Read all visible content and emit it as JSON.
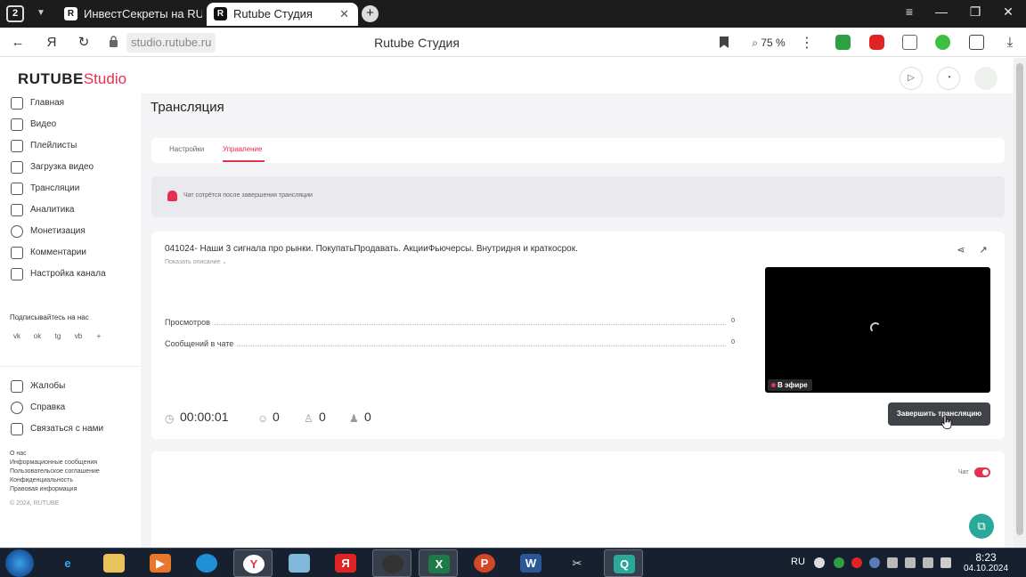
{
  "browser": {
    "tab_count": "2",
    "tabs": [
      {
        "label": "ИнвестСекреты на RUTUBE",
        "favicon": "R"
      },
      {
        "label": "Rutube Студия",
        "favicon": "R",
        "close": "✕"
      }
    ],
    "new_tab": "+",
    "url": "studio.rutube.ru",
    "page_title": "Rutube Студия",
    "zoom": "75 %"
  },
  "app": {
    "logo_main": "RUTUBE",
    "logo_studio": "Studio",
    "nav": [
      {
        "label": "Главная",
        "icon": "home-icon"
      },
      {
        "label": "Видео",
        "icon": "video-icon"
      },
      {
        "label": "Плейлисты",
        "icon": "playlist-icon"
      },
      {
        "label": "Загрузка видео",
        "icon": "upload-icon"
      },
      {
        "label": "Трансляции",
        "icon": "broadcast-icon"
      },
      {
        "label": "Аналитика",
        "icon": "analytics-icon"
      },
      {
        "label": "Монетизация",
        "icon": "monetization-icon"
      },
      {
        "label": "Комментарии",
        "icon": "comments-icon"
      },
      {
        "label": "Настройка канала",
        "icon": "channel-settings-icon"
      }
    ],
    "subscribe_label": "Подписывайтесь на нас",
    "social": [
      "vk",
      "ok",
      "tg",
      "vb",
      "+"
    ],
    "secondary_nav": [
      {
        "label": "Жалобы",
        "icon": "flag-icon"
      },
      {
        "label": "Справка",
        "icon": "help-icon"
      },
      {
        "label": "Связаться с нами",
        "icon": "contact-icon"
      }
    ],
    "footer_links": [
      "О нас",
      "Информационные сообщения",
      "Пользовательское соглашение",
      "Конфиденциальность",
      "Правовая информация"
    ],
    "copyright": "© 2024, RUTUBE"
  },
  "main": {
    "heading": "Трансляция",
    "tabs": [
      {
        "label": "Настройки",
        "active": false
      },
      {
        "label": "Управление",
        "active": true
      }
    ],
    "notice": "Чат сотрётся после завершения трансляции",
    "stream": {
      "title": "041024- Наши 3 сигнала про рынки. ПокупатьПродавать. АкцииФьючерсы. Внутридня и краткосрок.",
      "show_description": "Показать описание ⌄",
      "stats": [
        {
          "label": "Просмотров",
          "value": "0"
        },
        {
          "label": "Сообщений в чате",
          "value": "0"
        }
      ],
      "live_badge": "В эфире",
      "duration": "00:00:01",
      "viewers": "0",
      "likes": "0",
      "dislikes": "0",
      "end_button": "Завершить трансляцию"
    },
    "chat_label": "Чат",
    "chat_enabled": true
  },
  "taskbar": {
    "language": "RU",
    "time": "8:23",
    "date": "04.10.2024"
  },
  "colors": {
    "accent": "#e6304f",
    "end_button": "#3f4247",
    "help_fab": "#2aa99b"
  }
}
